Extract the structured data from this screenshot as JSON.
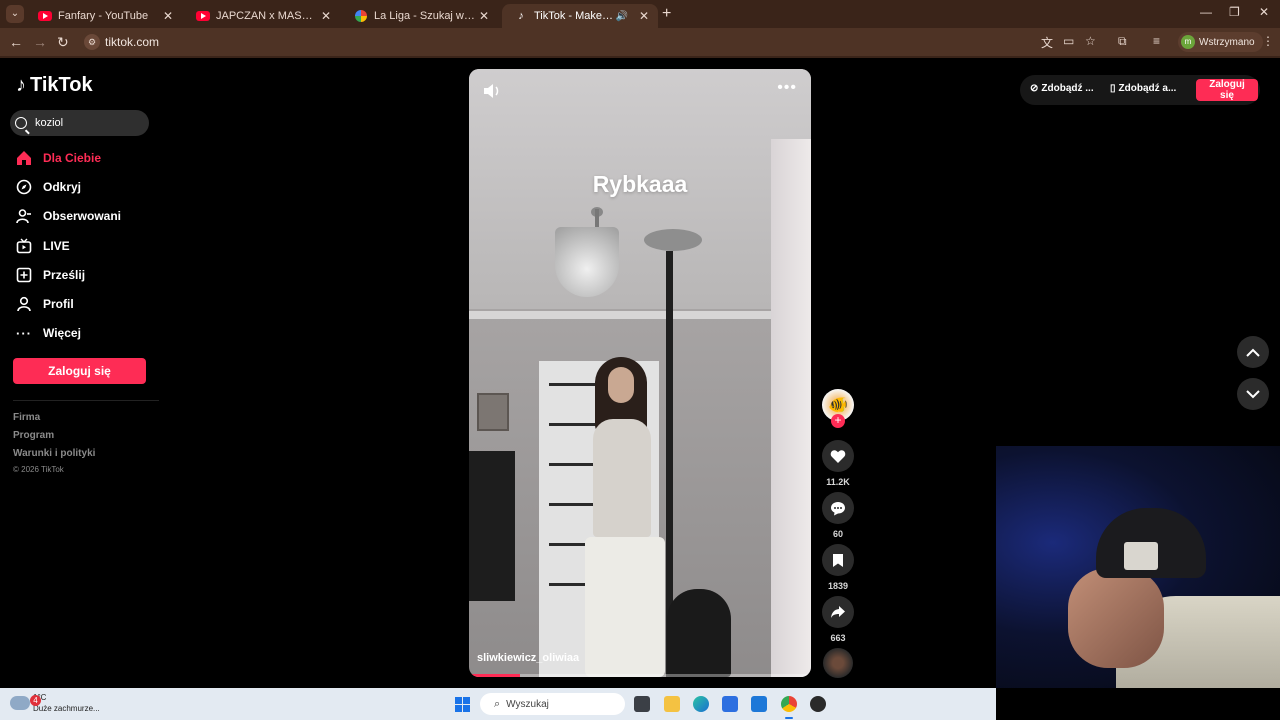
{
  "browser": {
    "tabs": [
      {
        "title": "Fanfary - YouTube",
        "icon": "youtube-icon"
      },
      {
        "title": "JAPCZAN x MASNY BEN - SHA",
        "icon": "youtube-icon"
      },
      {
        "title": "La Liga - Szukaj w Google",
        "icon": "google-icon"
      },
      {
        "title": "TikTok - Make Your Day",
        "icon": "tiktok-icon",
        "active": true
      }
    ],
    "url": "tiktok.com",
    "profile_status": "Wstrzymano",
    "profile_initial": "m"
  },
  "tiktok": {
    "logo": "TikTok",
    "search_value": "koziol",
    "nav": [
      {
        "label": "Dla Ciebie",
        "icon": "home-icon",
        "active": true
      },
      {
        "label": "Odkryj",
        "icon": "compass-icon"
      },
      {
        "label": "Obserwowani",
        "icon": "following-icon"
      },
      {
        "label": "LIVE",
        "icon": "live-icon"
      },
      {
        "label": "Prześlij",
        "icon": "upload-icon"
      },
      {
        "label": "Profil",
        "icon": "profile-icon"
      },
      {
        "label": "Więcej",
        "icon": "more-icon"
      }
    ],
    "login_label": "Zaloguj się",
    "footer": {
      "links": [
        "Firma",
        "Program",
        "Warunki i polityki"
      ],
      "copyright": "© 2026 TikTok"
    },
    "video": {
      "caption": "Rybkaaa",
      "author": "sliwkiewicz_oliwiaa",
      "progress": 0.15,
      "counts": {
        "likes": "11.2K",
        "comments": "60",
        "bookmarks": "1839",
        "shares": "663"
      }
    },
    "topright": {
      "link1": "Zdobądź ...",
      "link2": "Zdobądź a...",
      "login": "Zaloguj się"
    }
  },
  "taskbar": {
    "weather_temp": "1°C",
    "weather_desc": "Duże zachmurze...",
    "weather_badge": "4",
    "search_placeholder": "Wyszukaj"
  },
  "colors": {
    "accent": "#fe2c55",
    "chrome": "#4e3325"
  }
}
